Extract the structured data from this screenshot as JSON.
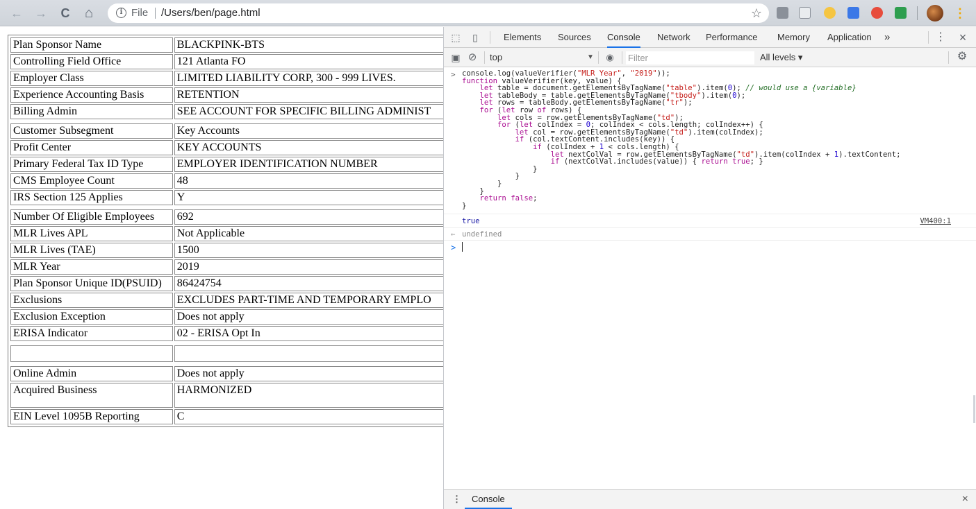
{
  "browser": {
    "url_scheme": "File",
    "url_path": "/Users/ben/page.html",
    "icons": {
      "back": "arrow-left-icon",
      "forward": "arrow-right-icon",
      "reload": "reload-icon",
      "home": "home-icon",
      "info": "info-icon",
      "bookmark": "star-icon",
      "menu": "kebab-menu-icon"
    },
    "back_glyph": "←",
    "forward_glyph": "→",
    "reload_glyph": "C",
    "home_glyph": "⌂",
    "info_glyph": "i",
    "star_glyph": "☆",
    "menu_glyph": "⋮"
  },
  "table": {
    "groups": [
      {
        "rows": [
          {
            "key": "Plan Sponsor Name",
            "value": "BLACKPINK-BTS"
          },
          {
            "key": "Controlling Field Office",
            "value": "121  Atlanta FO"
          },
          {
            "key": "Employer Class",
            "value": "LIMITED LIABILITY CORP, 300 - 999 LIVES."
          },
          {
            "key": "Experience Accounting Basis",
            "value": "RETENTION"
          },
          {
            "key": "Billing Admin",
            "value": "SEE ACCOUNT FOR SPECIFIC BILLING ADMINIST"
          }
        ]
      },
      {
        "rows": [
          {
            "key": "Customer Subsegment",
            "value": "Key Accounts"
          },
          {
            "key": "Profit Center",
            "value": "KEY ACCOUNTS"
          },
          {
            "key": "Primary Federal Tax ID Type",
            "value": "EMPLOYER IDENTIFICATION NUMBER"
          },
          {
            "key": "CMS Employee Count",
            "value": "48"
          },
          {
            "key": "IRS Section 125 Applies",
            "value": "Y"
          }
        ]
      },
      {
        "rows": [
          {
            "key": "Number Of Eligible Employees",
            "value": "692"
          },
          {
            "key": "MLR Lives APL",
            "value": "Not Applicable"
          },
          {
            "key": "MLR Lives (TAE)",
            "value": "1500"
          },
          {
            "key": "MLR Year",
            "value": "2019"
          },
          {
            "key": "Plan Sponsor Unique ID(PSUID)",
            "value": "86424754"
          },
          {
            "key": "Exclusions",
            "value": "EXCLUDES PART-TIME AND TEMPORARY EMPLO"
          },
          {
            "key": "Exclusion Exception",
            "value": "Does not apply"
          },
          {
            "key": "ERISA Indicator",
            "value": "02 - ERISA Opt In"
          }
        ]
      },
      {
        "rows": [
          {
            "key": "",
            "value": ""
          }
        ]
      },
      {
        "rows": [
          {
            "key": "Online Admin",
            "value": "Does not apply"
          },
          {
            "key": "Acquired Business",
            "value": "HARMONIZED"
          },
          {
            "key": "EIN Level 1095B Reporting",
            "value": "C"
          }
        ]
      }
    ]
  },
  "devtools": {
    "tabs": [
      "Elements",
      "Sources",
      "Console",
      "Network",
      "Performance",
      "Memory",
      "Application"
    ],
    "active_tab": "Console",
    "more_tabs_glyph": "»",
    "kebab_glyph": "⋮",
    "close_glyph": "×",
    "icons": {
      "inspect": "inspect-element-icon",
      "device": "device-toolbar-icon",
      "sidebar": "console-sidebar-icon",
      "clear": "clear-console-icon",
      "eye": "live-expression-eye-icon",
      "settings": "gear-icon"
    },
    "context": "top",
    "context_arrow": "▼",
    "filter_placeholder": "Filter",
    "levels": "All levels ▾",
    "gear_glyph": "⚙",
    "clear_glyph": "⊘",
    "eye_glyph": "◉",
    "console": {
      "input_prompt": ">",
      "code_lines": [
        "console.log(valueVerifier(\"MLR Year\", \"2019\"));",
        "function valueVerifier(key, value) {",
        "    let table = document.getElementsByTagName(\"table\").item(0); // would use a {variable}",
        "    let tableBody = table.getElementsByTagName(\"tbody\").item(0);",
        "    let rows = tableBody.getElementsByTagName(\"tr\");",
        "    for (let row of rows) {",
        "        let cols = row.getElementsByTagName(\"td\");",
        "        for (let colIndex = 0; colIndex < cols.length; colIndex++) {",
        "            let col = row.getElementsByTagName(\"td\").item(colIndex);",
        "            if (col.textContent.includes(key)) {",
        "                if (colIndex + 1 < cols.length) {",
        "                    let nextColVal = row.getElementsByTagName(\"td\").item(colIndex + 1).textContent;",
        "                    if (nextColVal.includes(value)) { return true; }",
        "                }",
        "            }",
        "        }",
        "    }",
        "    return false;",
        "}"
      ],
      "log_output": "true",
      "log_source": "VM400:1",
      "return_arrow": "←",
      "return_value": "undefined",
      "next_prompt": ">"
    },
    "drawer": {
      "menu_glyph": "⋮",
      "tab": "Console",
      "close_glyph": "×"
    }
  },
  "colors": {
    "devtools_active_tab": "#1a73e8",
    "console_true": "#1a1aa6",
    "keyword": "#aa0d91",
    "string": "#c41a16",
    "comment": "#236e25"
  }
}
